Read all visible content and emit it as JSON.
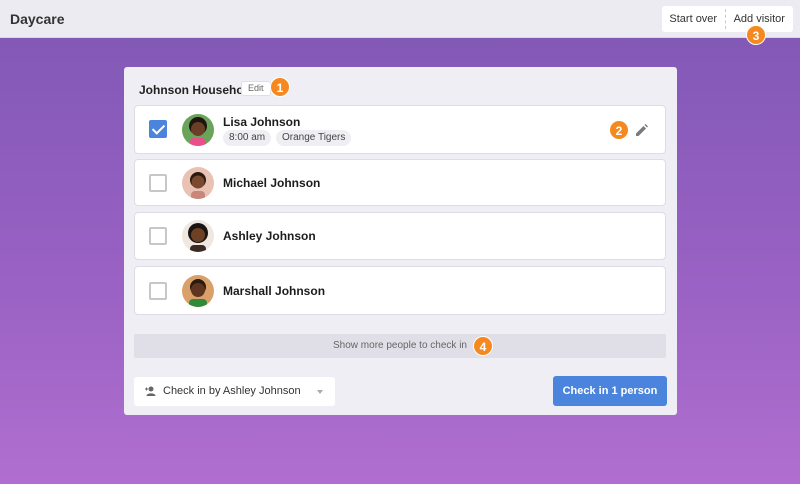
{
  "app": {
    "title": "Daycare"
  },
  "header": {
    "start_over_label": "Start over",
    "add_visitor_label": "Add visitor"
  },
  "household": {
    "title": "Johnson Household",
    "edit_label": "Edit"
  },
  "people": [
    {
      "name": "Lisa Johnson",
      "checked": true,
      "time": "8:00 am",
      "group": "Orange Tigers"
    },
    {
      "name": "Michael Johnson",
      "checked": false
    },
    {
      "name": "Ashley Johnson",
      "checked": false
    },
    {
      "name": "Marshall Johnson",
      "checked": false
    }
  ],
  "show_more_label": "Show more people to check in",
  "checkin_by": {
    "label": "Check in by Ashley Johnson"
  },
  "checkin_button_label": "Check in 1 person",
  "badges": [
    "1",
    "2",
    "3",
    "4"
  ],
  "colors": {
    "accent": "#4a84dc",
    "badge": "#f5891f",
    "background": "#8f5cbd"
  }
}
